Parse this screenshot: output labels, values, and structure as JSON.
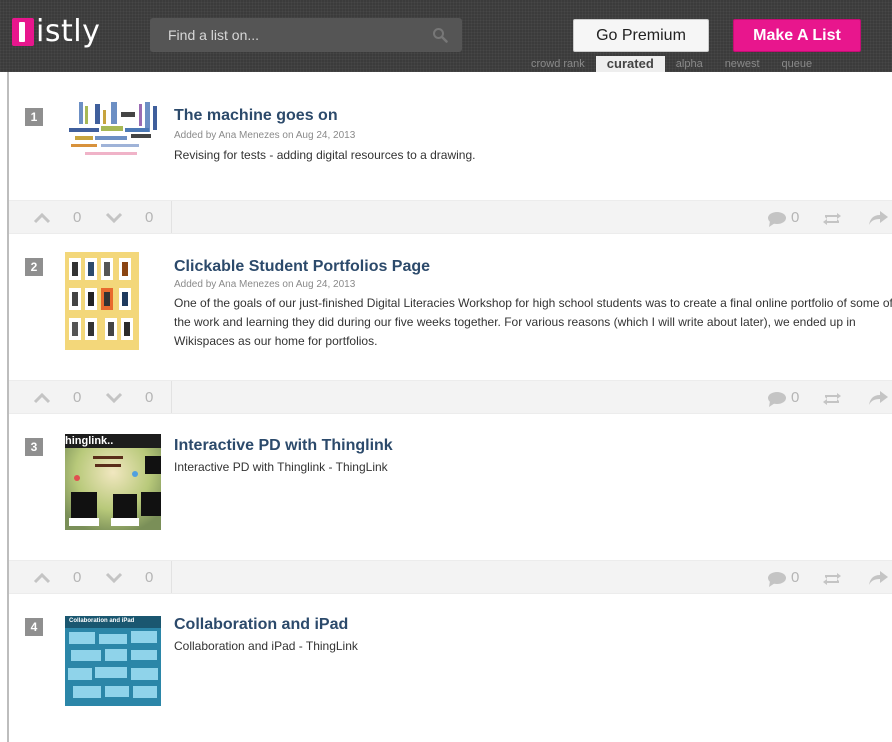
{
  "app": {
    "logo_text": "istly"
  },
  "header": {
    "search_placeholder": "Find a list on...",
    "premium_label": "Go Premium",
    "make_label": "Make A List",
    "sort_tabs": [
      "crowd rank",
      "curated",
      "alpha",
      "newest",
      "queue"
    ],
    "active_sort": "curated"
  },
  "colors": {
    "brand": "#e8168d",
    "title": "#2c4a6b",
    "header_bg": "#3b3b3b"
  },
  "items": [
    {
      "rank": "1",
      "title": "The machine goes on",
      "meta": "Added by Ana Menezes on Aug 24, 2013",
      "desc": "Revising for tests - adding digital resources to a drawing.",
      "thumb": "word-cloud",
      "up": "0",
      "down": "0",
      "comments": "0"
    },
    {
      "rank": "2",
      "title": "Clickable Student Portfolios Page",
      "meta": "Added by Ana Menezes on Aug 24, 2013",
      "desc": "One of the goals of our just-finished Digital Literacies Workshop for high school students was to create a final online portfolio of some of the work and learning they did during our five weeks together. For various reasons (which I will write about later), we ended up in Wikispaces as our home for portfolios.",
      "thumb": "student-grid",
      "up": "0",
      "down": "0",
      "comments": "0"
    },
    {
      "rank": "3",
      "title": "Interactive PD with Thinglink",
      "meta": "",
      "desc": "Interactive PD with Thinglink - ThingLink",
      "thumb_text": "hinglink..",
      "thumb": "thinglink",
      "up": "0",
      "down": "0",
      "comments": "0"
    },
    {
      "rank": "4",
      "title": "Collaboration and iPad",
      "meta": "",
      "desc": "Collaboration and iPad - ThingLink",
      "thumb_text": "Collaboration and iPad",
      "thumb": "collab-ipad"
    }
  ]
}
